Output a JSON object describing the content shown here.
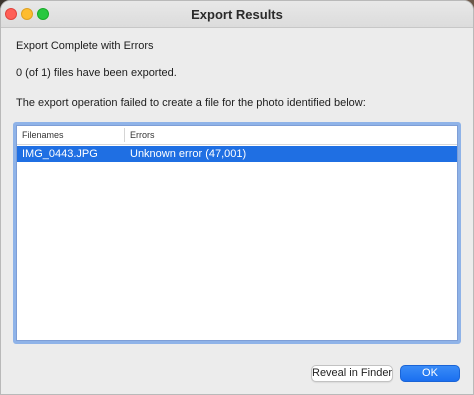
{
  "window": {
    "title": "Export Results"
  },
  "messages": {
    "heading": "Export Complete with Errors",
    "count": "0 (of 1) files have been exported.",
    "detail": "The export operation failed to create a file for the photo identified below:"
  },
  "table": {
    "columns": [
      "Filenames",
      "Errors"
    ],
    "rows": [
      {
        "filename": "IMG_0443.JPG",
        "error": "Unknown error (47,001)",
        "selected": true
      }
    ]
  },
  "buttons": {
    "reveal_label": "Reveal in Finder",
    "ok_label": "OK"
  },
  "colors": {
    "selection": "#1f6fe3",
    "default_button": "#1b6ff0",
    "focus_ring": "#8fb3e8"
  }
}
